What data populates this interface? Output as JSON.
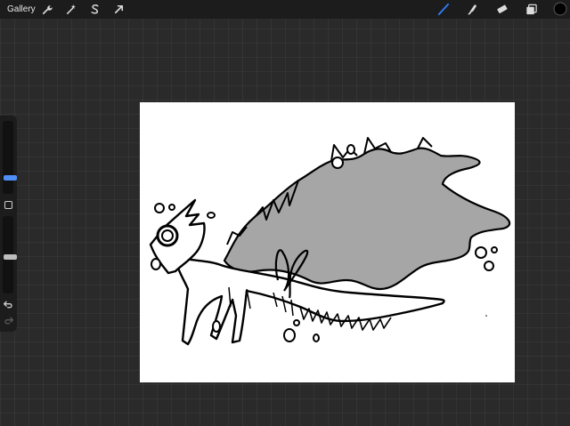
{
  "topbar": {
    "gallery_label": "Gallery",
    "left_tools": [
      {
        "name": "wrench-icon"
      },
      {
        "name": "magic-wand-icon"
      },
      {
        "name": "selection-s-icon"
      },
      {
        "name": "transform-arrow-icon"
      }
    ],
    "right_tools": [
      {
        "name": "brush-icon",
        "active": true
      },
      {
        "name": "smudge-icon"
      },
      {
        "name": "eraser-icon"
      },
      {
        "name": "layers-icon"
      },
      {
        "name": "color-swatch-icon"
      }
    ],
    "accent_color": "#2f7cf6",
    "current_color": "#000000"
  },
  "sidebar": {
    "brush_size_level": 0.2,
    "opacity_level": 0.47,
    "modify_button": "square-modify-icon",
    "undo_icon": "undo-icon",
    "redo_icon": "redo-icon"
  },
  "canvas": {
    "background": "#ffffff",
    "wing_fill": "#a6a6a6",
    "line_color": "#000000"
  }
}
